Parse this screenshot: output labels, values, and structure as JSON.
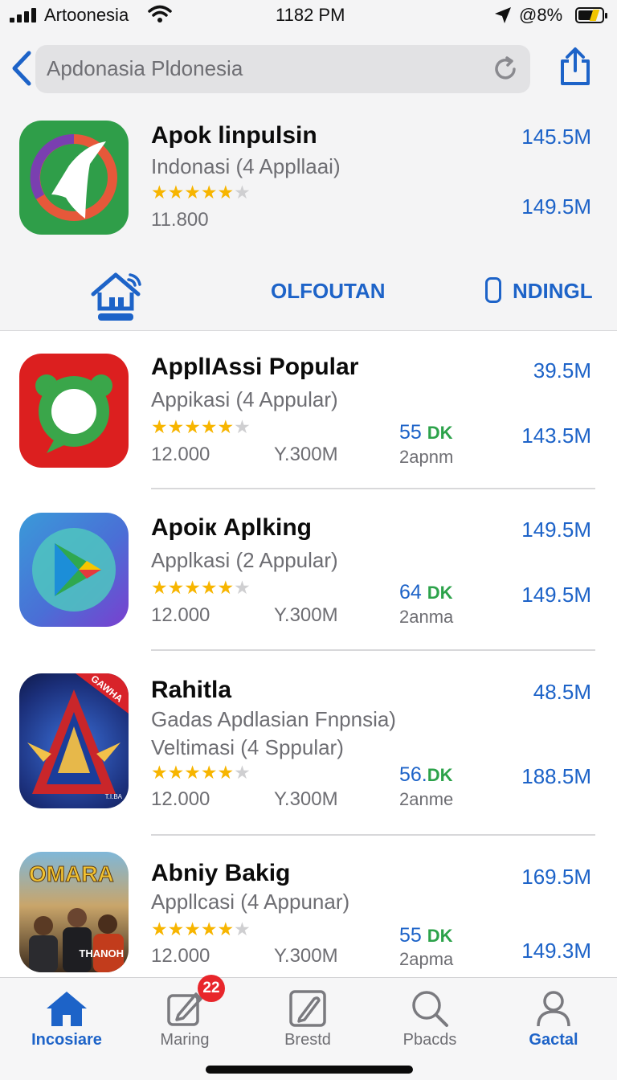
{
  "status_bar": {
    "carrier": "Artoonesia",
    "time": "1182 PM",
    "battery_percent": "8%",
    "battery_icon_text": "@"
  },
  "nav": {
    "search_text": "Apdonasia Pldonesia",
    "back_icon": "chevron-left-icon",
    "reload_icon": "reload-icon",
    "share_icon": "share-icon"
  },
  "featured": {
    "title": "Apok linpulsin",
    "subtitle": "Indonasi  (4 Appllaai)",
    "rating": 4.5,
    "count": "11.800",
    "size_top": "145.5M",
    "size_bottom": "149.5M"
  },
  "categories": {
    "home_icon": "home-icon",
    "middle": "OLFOUTAN",
    "right_icon": "phone-icon",
    "right": "NDINGL"
  },
  "apps": [
    {
      "title": "ApplIAssi Popular",
      "subtitle": "Appikasi  (4 Appular)",
      "subtitle2": "",
      "count": "12.000",
      "size": "Y.300M",
      "downloads": "55",
      "downloads_unit": "DK",
      "downloads_sub": "2apnm",
      "size_top": "39.5M",
      "size_bottom": "143.5M"
    },
    {
      "title": "Apoiк Aplking",
      "subtitle": "Applkasi  (2 Appular)",
      "subtitle2": "",
      "count": "12.000",
      "size": "Y.300M",
      "downloads": "64",
      "downloads_unit": "DK",
      "downloads_sub": "2anma",
      "size_top": "149.5M",
      "size_bottom": "149.5M"
    },
    {
      "title": "Rahitla",
      "subtitle": "Gadas Apdlasian Fnpnsia)",
      "subtitle2": "Veltimasi  (4 Sppular)",
      "count": "12.000",
      "size": "Y.300M",
      "downloads": "56.",
      "downloads_unit": "DK",
      "downloads_sub": "2anme",
      "size_top": "48.5M",
      "size_bottom": "188.5M",
      "icon_text": "GAWHA",
      "icon_small": "T.I.BA"
    },
    {
      "title": "Abniy Bakig",
      "subtitle": "Appllcasi  (4 Appunar)",
      "subtitle2": "",
      "count": "12.000",
      "size": "Y.300M",
      "downloads": "55",
      "downloads_unit": "DK",
      "downloads_sub": "2apma",
      "size_top": "169.5M",
      "size_bottom": "149.3M",
      "icon_text": "OMARA",
      "icon_small": "THANOH"
    }
  ],
  "tab_bar": {
    "tabs": [
      {
        "label": "Incosiare",
        "icon": "home-icon"
      },
      {
        "label": "Maring",
        "icon": "pencil-square-icon"
      },
      {
        "label": "Brestd",
        "icon": "pen-square-icon"
      },
      {
        "label": "Pbacds",
        "icon": "search-icon"
      },
      {
        "label": "Gactal",
        "icon": "person-icon"
      }
    ],
    "badge": "22"
  },
  "colors": {
    "accent": "#1d63c8",
    "star": "#f7b500",
    "badge": "#e8262b",
    "download_unit": "#2ca24a"
  }
}
